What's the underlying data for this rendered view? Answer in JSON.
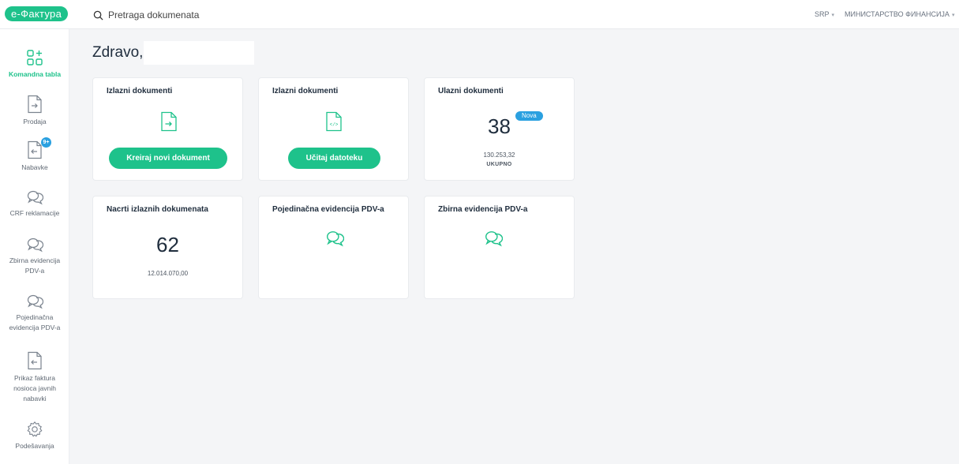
{
  "app": {
    "logo": "е-Фактура"
  },
  "header": {
    "search_placeholder": "Pretraga dokumenata",
    "language": "SRP",
    "organization": "МИНИСТАРСТВО ФИНАНСИЈА",
    "dropdown_caret": "▾"
  },
  "sidebar": {
    "items": [
      {
        "label": "Komandna tabla",
        "icon": "dashboard-icon",
        "active": true
      },
      {
        "label": "Prodaja",
        "icon": "document-arrow-right-icon"
      },
      {
        "label": "Nabavke",
        "icon": "document-arrow-left-icon",
        "badge": "9+"
      },
      {
        "label": "CRF reklamacije",
        "icon": "chat-bubbles-icon"
      },
      {
        "label": "Zbirna evidencija PDV-a",
        "icon": "chat-bubbles-icon"
      },
      {
        "label": "Pojedinačna evidencija PDV-a",
        "icon": "chat-bubbles-icon"
      },
      {
        "label": "Prikaz faktura nosioca javnih nabavki",
        "icon": "document-arrow-left-icon"
      },
      {
        "label": "Podešavanja",
        "icon": "gear-icon"
      }
    ]
  },
  "main": {
    "greeting": "Zdravo,",
    "cards": [
      {
        "title": "Izlazni dokumenti",
        "button": "Kreiraj novi dokument",
        "icon": "document-arrow-right-icon"
      },
      {
        "title": "Izlazni dokumenti",
        "button": "Učitaj datoteku",
        "icon": "document-code-icon"
      },
      {
        "title": "Ulazni dokumenti",
        "count": "38",
        "badge": "Nova",
        "amount": "130.253,32",
        "amount_label": "UKUPNO"
      },
      {
        "title": "Nacrti izlaznih dokumenata",
        "count": "62",
        "amount": "12.014.070,00"
      },
      {
        "title": "Pojedinačna evidencija PDV-a",
        "icon": "chat-bubbles-icon"
      },
      {
        "title": "Zbirna evidencija PDV-a",
        "icon": "chat-bubbles-icon"
      }
    ]
  },
  "colors": {
    "accent": "#1ec28b",
    "badge_blue": "#2aa0e0",
    "text": "#1f2d3d",
    "background": "#f4f5f7"
  }
}
